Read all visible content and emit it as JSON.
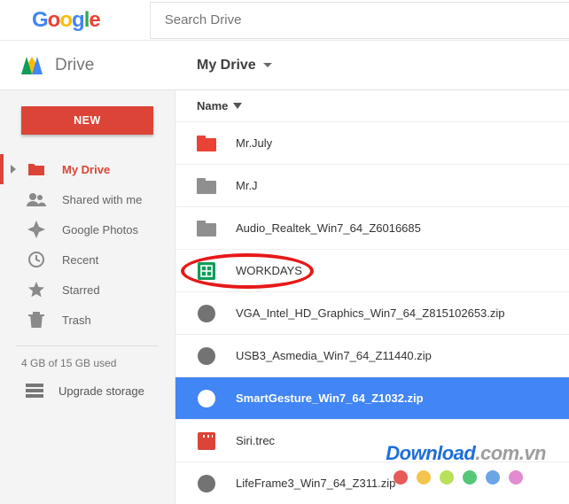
{
  "search": {
    "placeholder": "Search Drive"
  },
  "drive_label": "Drive",
  "location": "My Drive",
  "new_button": "NEW",
  "sidebar": {
    "items": [
      {
        "label": "My Drive",
        "id": "my-drive"
      },
      {
        "label": "Shared with me",
        "id": "shared"
      },
      {
        "label": "Google Photos",
        "id": "photos"
      },
      {
        "label": "Recent",
        "id": "recent"
      },
      {
        "label": "Starred",
        "id": "starred"
      },
      {
        "label": "Trash",
        "id": "trash"
      }
    ],
    "storage_text": "4 GB of 15 GB used",
    "upgrade_label": "Upgrade storage"
  },
  "column_header": "Name",
  "files": [
    {
      "name": "Mr.July",
      "type": "folder-red"
    },
    {
      "name": "Mr.J",
      "type": "folder-grey"
    },
    {
      "name": "Audio_Realtek_Win7_64_Z6016685",
      "type": "folder-grey"
    },
    {
      "name": "WORKDAYS",
      "type": "sheets",
      "highlighted": true
    },
    {
      "name": "VGA_Intel_HD_Graphics_Win7_64_Z815102653.zip",
      "type": "zip"
    },
    {
      "name": "USB3_Asmedia_Win7_64_Z11440.zip",
      "type": "zip"
    },
    {
      "name": "SmartGesture_Win7_64_Z1032.zip",
      "type": "zip",
      "selected": true
    },
    {
      "name": "Siri.trec",
      "type": "siri"
    },
    {
      "name": "LifeFrame3_Win7_64_Z311.zip",
      "type": "zip"
    }
  ],
  "watermark": {
    "text_main": "Download",
    "text_suffix": ".com.vn"
  },
  "dot_colors": [
    "#e65a5a",
    "#f4c54e",
    "#b9e05a",
    "#55c878",
    "#6aa6e6",
    "#e28bd0"
  ]
}
